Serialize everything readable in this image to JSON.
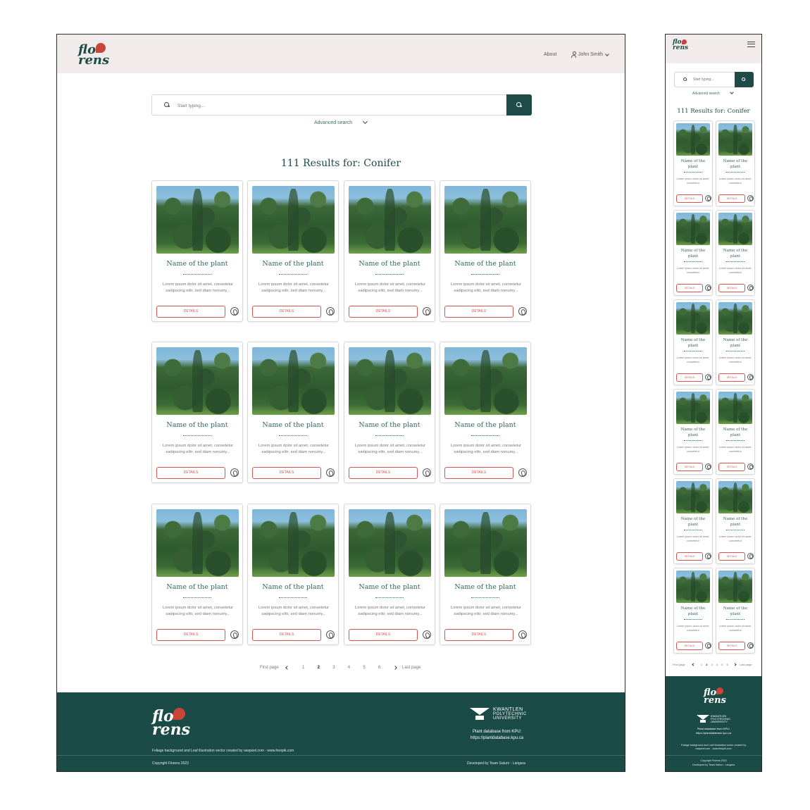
{
  "brand": {
    "logo_line1": "flo",
    "logo_line2": "rens"
  },
  "desktop": {
    "nav": {
      "about": "About",
      "user_name": "John Smith"
    },
    "search": {
      "placeholder": "Start typing...",
      "advanced": "Advanced search"
    },
    "results_title": "111 Results for: Conifer",
    "card": {
      "name": "Name of the plant",
      "description": "Lorem ipsum dolor sit amet, consetetur sadipscing elitr, sed diam nonumy...",
      "button": "DETAILS"
    },
    "pagination": {
      "first": "First page",
      "pages": [
        "1",
        "2",
        "3",
        "4",
        "5",
        "6"
      ],
      "current": "2",
      "last": "Last page"
    },
    "footer": {
      "credits": "Foliage background and Leaf illustration vector created by rawpixel.com - www.freepik.com",
      "copyright": "Copyright Florens 2022",
      "kpu_line1": "KWANTLEN",
      "kpu_line2": "POLYTECHNIC",
      "kpu_line3": "UNIVERSITY",
      "database_label": "Plant database from KPU:",
      "database_url": "https://plantdatabase.kpu.ca",
      "developed_by": "Developed by Team Saturn - Langara"
    }
  },
  "mobile": {
    "search": {
      "placeholder": "Start typing...",
      "advanced": "Advanced search"
    },
    "results_title": "111 Results for: Conifer",
    "card": {
      "name": "Name of the plant",
      "description": "Lorem ipsum dolor sit amet, consetetur",
      "button": "DETAILS"
    },
    "pagination": {
      "first": "First page",
      "pages": [
        "1",
        "2",
        "3",
        "4",
        "5",
        "6"
      ],
      "last": "Last page"
    },
    "footer": {
      "kpu_line1": "KWANTLEN",
      "kpu_line2": "POLYTECHNIC",
      "kpu_line3": "UNIVERSITY",
      "database_label": "Plant database from KPU:",
      "database_url": "https://plantdatabase.kpu.ca",
      "credits": "Foliage background and Leaf illustration vector created by rawpixel.com - www.freepik.com",
      "copyright": "Copyright Florens 2022",
      "developed_by": "Developed by Team Saturn - Langara"
    }
  },
  "colors": {
    "accent": "#1e4b47",
    "button_red": "#d9534f",
    "header_bg": "#f1eceb",
    "footer_bg": "#1b4b47"
  }
}
